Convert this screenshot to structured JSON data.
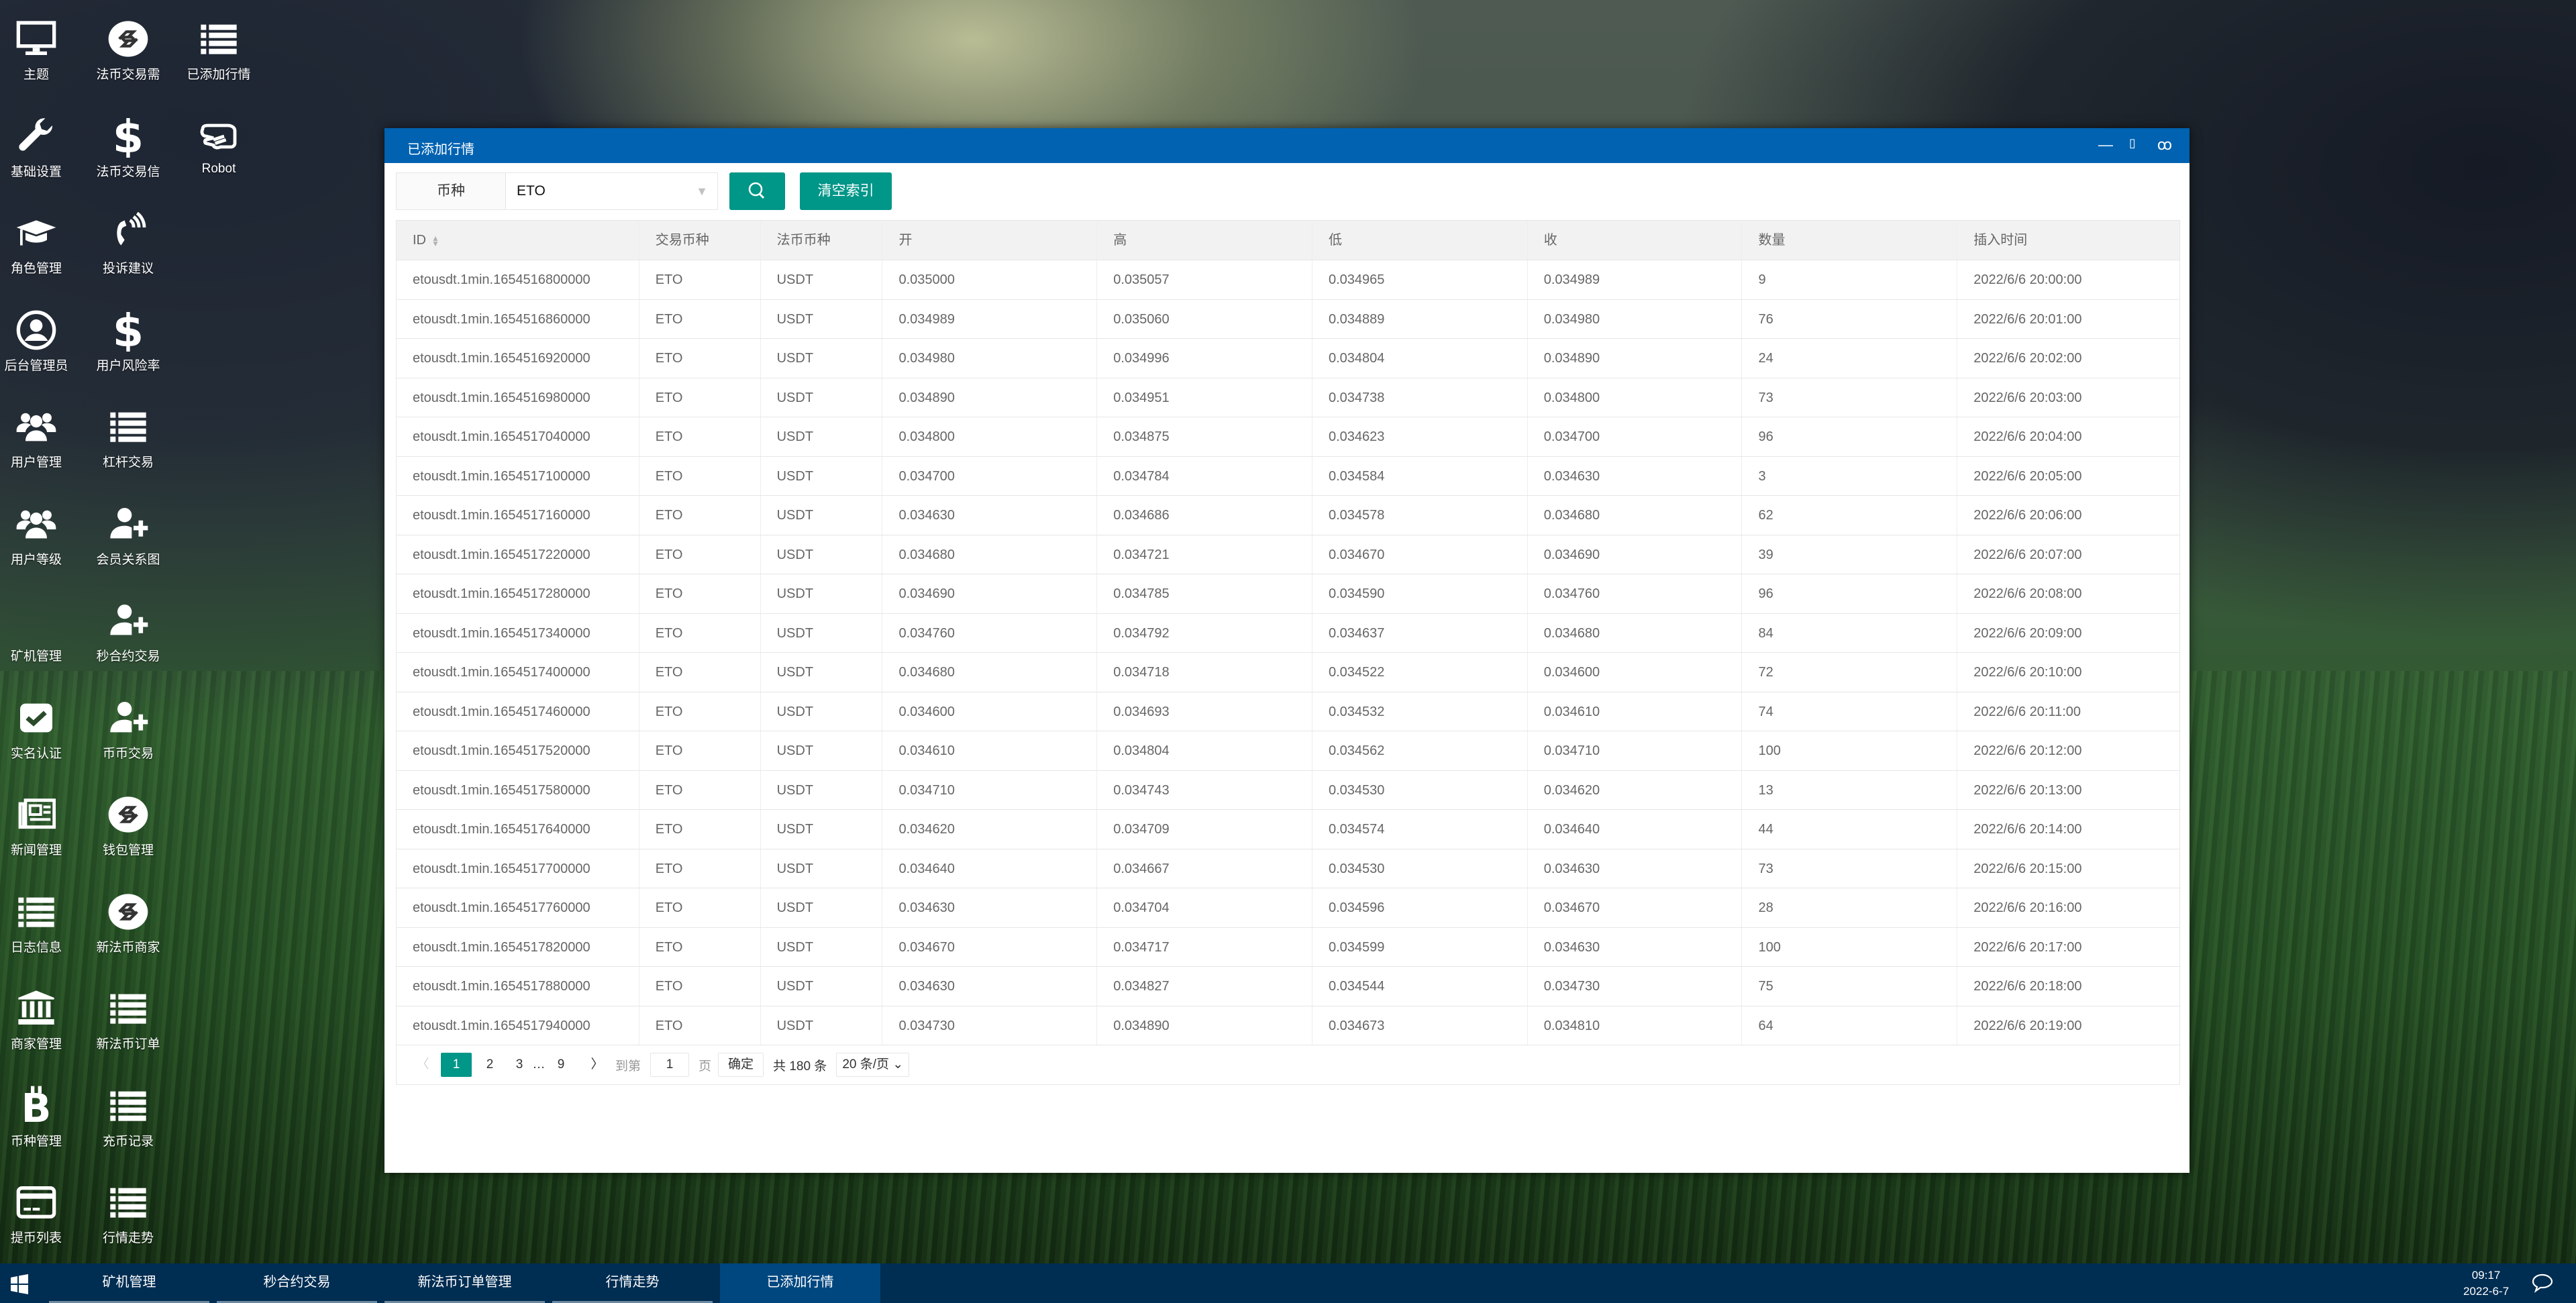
{
  "desktop": {
    "columns": [
      [
        {
          "label": "主题",
          "icon": "monitor"
        },
        {
          "label": "基础设置",
          "icon": "wrench"
        },
        {
          "label": "角色管理",
          "icon": "graduation-cap"
        },
        {
          "label": "后台管理员",
          "icon": "user-circle"
        },
        {
          "label": "用户管理",
          "icon": "users"
        },
        {
          "label": "用户等级",
          "icon": "users"
        },
        {
          "label": "矿机管理",
          "icon": "blank"
        },
        {
          "label": "实名认证",
          "icon": "check-square"
        },
        {
          "label": "新闻管理",
          "icon": "newspaper"
        },
        {
          "label": "日志信息",
          "icon": "list"
        },
        {
          "label": "商家管理",
          "icon": "bank"
        },
        {
          "label": "币种管理",
          "icon": "bitcoin"
        },
        {
          "label": "提币列表",
          "icon": "credit-card"
        }
      ],
      [
        {
          "label": "法币交易需",
          "icon": "exchange-circle"
        },
        {
          "label": "法币交易信",
          "icon": "dollar"
        },
        {
          "label": "投诉建议",
          "icon": "phone-volume"
        },
        {
          "label": "用户风险率",
          "icon": "dollar"
        },
        {
          "label": "杠杆交易",
          "icon": "list"
        },
        {
          "label": "会员关系图",
          "icon": "user-plus"
        },
        {
          "label": "秒合约交易",
          "icon": "user-plus"
        },
        {
          "label": "币币交易",
          "icon": "user-plus"
        },
        {
          "label": "钱包管理",
          "icon": "exchange-circle"
        },
        {
          "label": "新法币商家",
          "icon": "exchange-circle"
        },
        {
          "label": "新法币订单",
          "icon": "list"
        },
        {
          "label": "充币记录",
          "icon": "list"
        },
        {
          "label": "行情走势",
          "icon": "list"
        }
      ],
      [
        {
          "label": "已添加行情",
          "icon": "list"
        },
        {
          "label": "Robot",
          "icon": "hand-peace"
        }
      ]
    ]
  },
  "window": {
    "title": "已添加行情",
    "controls": {
      "minimize": "—",
      "maximize": "▯",
      "close": "ꝏ"
    },
    "filter": {
      "label": "币种",
      "value": "ETO",
      "search_icon": "search",
      "clear_label": "清空索引"
    },
    "table": {
      "columns": [
        "ID",
        "交易币种",
        "法币币种",
        "开",
        "高",
        "低",
        "收",
        "数量",
        "插入时间"
      ],
      "rows": [
        [
          "etousdt.1min.1654516800000",
          "ETO",
          "USDT",
          "0.035000",
          "0.035057",
          "0.034965",
          "0.034989",
          "9",
          "2022/6/6 20:00:00"
        ],
        [
          "etousdt.1min.1654516860000",
          "ETO",
          "USDT",
          "0.034989",
          "0.035060",
          "0.034889",
          "0.034980",
          "76",
          "2022/6/6 20:01:00"
        ],
        [
          "etousdt.1min.1654516920000",
          "ETO",
          "USDT",
          "0.034980",
          "0.034996",
          "0.034804",
          "0.034890",
          "24",
          "2022/6/6 20:02:00"
        ],
        [
          "etousdt.1min.1654516980000",
          "ETO",
          "USDT",
          "0.034890",
          "0.034951",
          "0.034738",
          "0.034800",
          "73",
          "2022/6/6 20:03:00"
        ],
        [
          "etousdt.1min.1654517040000",
          "ETO",
          "USDT",
          "0.034800",
          "0.034875",
          "0.034623",
          "0.034700",
          "96",
          "2022/6/6 20:04:00"
        ],
        [
          "etousdt.1min.1654517100000",
          "ETO",
          "USDT",
          "0.034700",
          "0.034784",
          "0.034584",
          "0.034630",
          "3",
          "2022/6/6 20:05:00"
        ],
        [
          "etousdt.1min.1654517160000",
          "ETO",
          "USDT",
          "0.034630",
          "0.034686",
          "0.034578",
          "0.034680",
          "62",
          "2022/6/6 20:06:00"
        ],
        [
          "etousdt.1min.1654517220000",
          "ETO",
          "USDT",
          "0.034680",
          "0.034721",
          "0.034670",
          "0.034690",
          "39",
          "2022/6/6 20:07:00"
        ],
        [
          "etousdt.1min.1654517280000",
          "ETO",
          "USDT",
          "0.034690",
          "0.034785",
          "0.034590",
          "0.034760",
          "96",
          "2022/6/6 20:08:00"
        ],
        [
          "etousdt.1min.1654517340000",
          "ETO",
          "USDT",
          "0.034760",
          "0.034792",
          "0.034637",
          "0.034680",
          "84",
          "2022/6/6 20:09:00"
        ],
        [
          "etousdt.1min.1654517400000",
          "ETO",
          "USDT",
          "0.034680",
          "0.034718",
          "0.034522",
          "0.034600",
          "72",
          "2022/6/6 20:10:00"
        ],
        [
          "etousdt.1min.1654517460000",
          "ETO",
          "USDT",
          "0.034600",
          "0.034693",
          "0.034532",
          "0.034610",
          "74",
          "2022/6/6 20:11:00"
        ],
        [
          "etousdt.1min.1654517520000",
          "ETO",
          "USDT",
          "0.034610",
          "0.034804",
          "0.034562",
          "0.034710",
          "100",
          "2022/6/6 20:12:00"
        ],
        [
          "etousdt.1min.1654517580000",
          "ETO",
          "USDT",
          "0.034710",
          "0.034743",
          "0.034530",
          "0.034620",
          "13",
          "2022/6/6 20:13:00"
        ],
        [
          "etousdt.1min.1654517640000",
          "ETO",
          "USDT",
          "0.034620",
          "0.034709",
          "0.034574",
          "0.034640",
          "44",
          "2022/6/6 20:14:00"
        ],
        [
          "etousdt.1min.1654517700000",
          "ETO",
          "USDT",
          "0.034640",
          "0.034667",
          "0.034530",
          "0.034630",
          "73",
          "2022/6/6 20:15:00"
        ],
        [
          "etousdt.1min.1654517760000",
          "ETO",
          "USDT",
          "0.034630",
          "0.034704",
          "0.034596",
          "0.034670",
          "28",
          "2022/6/6 20:16:00"
        ],
        [
          "etousdt.1min.1654517820000",
          "ETO",
          "USDT",
          "0.034670",
          "0.034717",
          "0.034599",
          "0.034630",
          "100",
          "2022/6/6 20:17:00"
        ],
        [
          "etousdt.1min.1654517880000",
          "ETO",
          "USDT",
          "0.034630",
          "0.034827",
          "0.034544",
          "0.034730",
          "75",
          "2022/6/6 20:18:00"
        ],
        [
          "etousdt.1min.1654517940000",
          "ETO",
          "USDT",
          "0.034730",
          "0.034890",
          "0.034673",
          "0.034810",
          "64",
          "2022/6/6 20:19:00"
        ]
      ]
    },
    "pagination": {
      "prev": "〈",
      "pages": [
        "1",
        "2",
        "3"
      ],
      "ellipsis": "…",
      "last": "9",
      "next": "〉",
      "current": "1",
      "goto_label": "到第",
      "goto_value": "1",
      "page_unit": "页",
      "confirm": "确定",
      "total": "共 180 条",
      "page_size": "20 条/页"
    }
  },
  "taskbar": {
    "tasks": [
      "矿机管理",
      "秒合约交易",
      "新法币订单管理",
      "行情走势",
      "已添加行情"
    ],
    "active_index": 4,
    "time": "09:17",
    "date": "2022-6-7"
  },
  "colors": {
    "accent": "#009688",
    "titlebar": "#0062b1",
    "taskbar": "#002d52",
    "taskbar_active": "#00477f"
  }
}
